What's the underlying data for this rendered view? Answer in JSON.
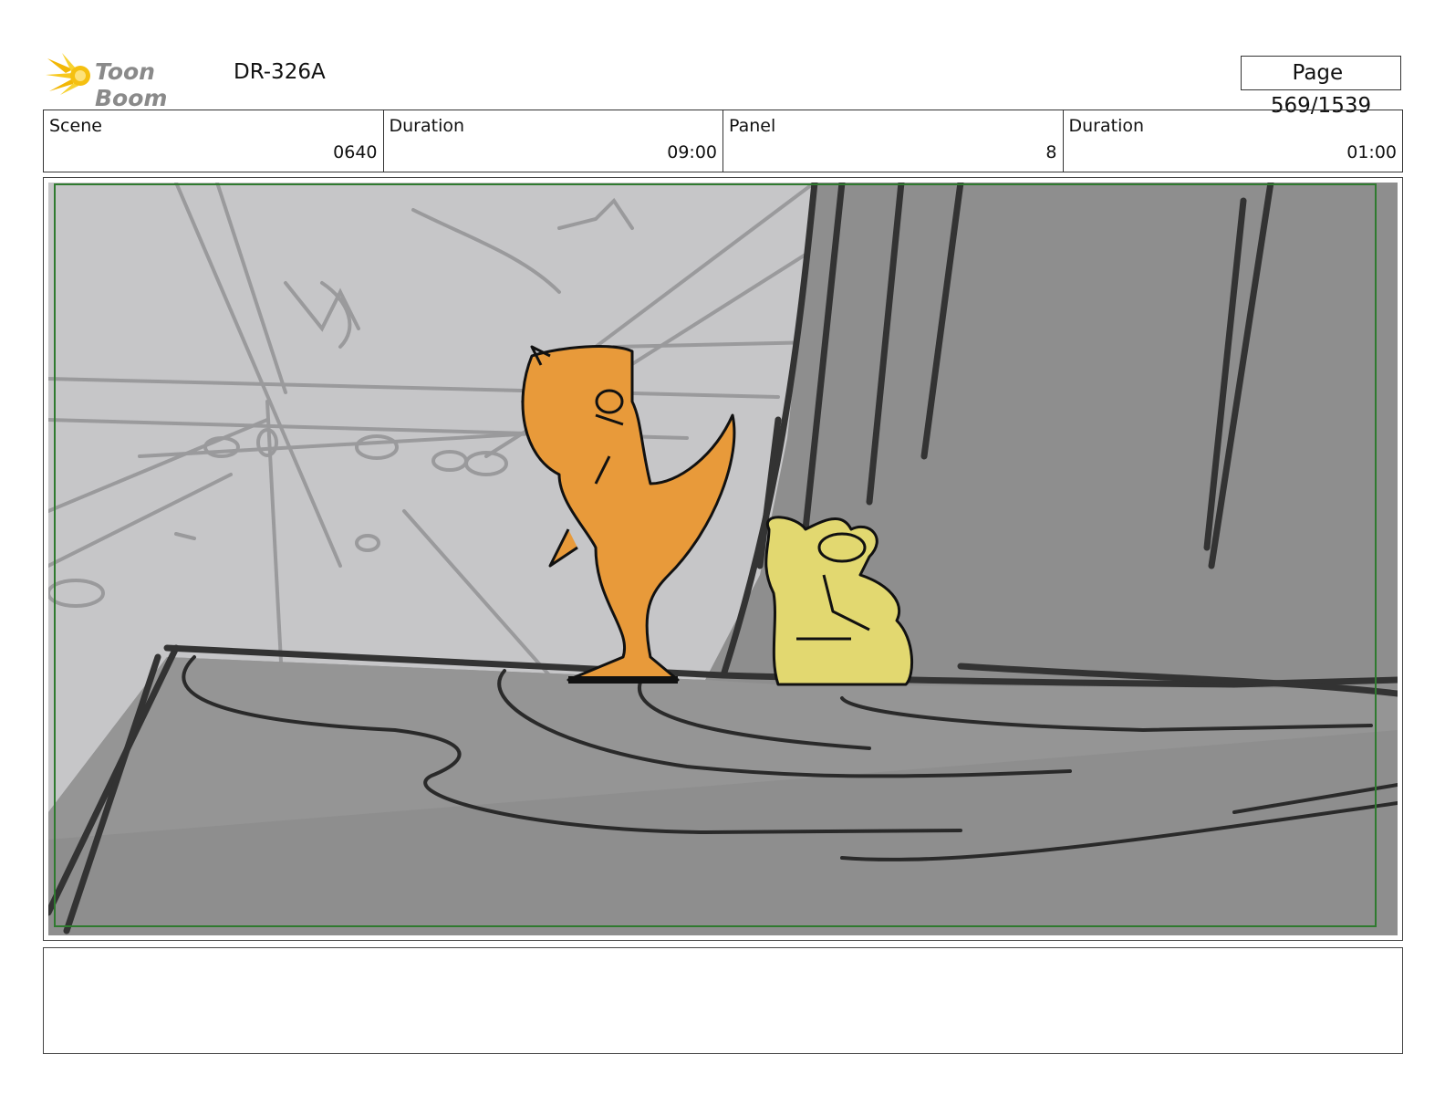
{
  "header": {
    "logo_text": "Toon Boom",
    "project_code": "DR-326A",
    "page_label": "Page",
    "page_value": "569/1539"
  },
  "info": {
    "scene_label": "Scene",
    "scene_value": "0640",
    "duration_label": "Duration",
    "duration_value": "09:00",
    "panel_label": "Panel",
    "panel_value": "8",
    "panel_duration_label": "Duration",
    "panel_duration_value": "01:00"
  },
  "colors": {
    "safe_frame": "#2f7a2f",
    "sky": "#c4c4c6",
    "rock": "#8f8f8f",
    "orange_character": "#e89a3a",
    "yellow_character": "#e2d870"
  },
  "icons": {
    "logo": "toon-boom-sun-icon"
  }
}
